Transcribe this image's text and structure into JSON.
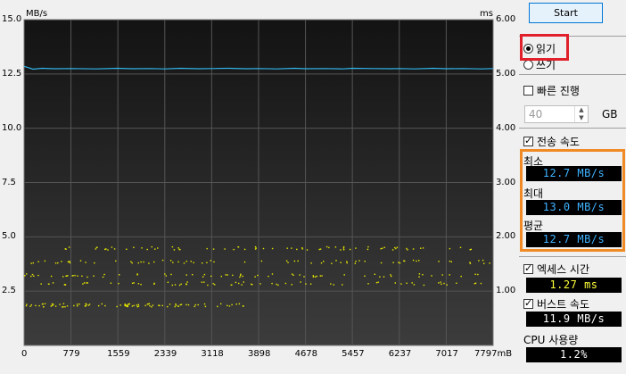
{
  "chart_data": {
    "type": "line",
    "left_unit": "MB/s",
    "right_unit": "ms",
    "y_ticks_left": [
      "15.0",
      "12.5",
      "10.0",
      "7.5",
      "5.0",
      "2.5"
    ],
    "y_ticks_right": [
      "6.00",
      "5.00",
      "4.00",
      "3.00",
      "2.00",
      "1.00"
    ],
    "ylim_left": [
      0,
      15
    ],
    "ylim_right": [
      0,
      6
    ],
    "x_ticks": [
      "0",
      "779",
      "1559",
      "2339",
      "3118",
      "3898",
      "4678",
      "5457",
      "6237",
      "7017",
      "7797mB"
    ],
    "x_tick_values": [
      0,
      779,
      1559,
      2339,
      3118,
      3898,
      4678,
      5457,
      6237,
      7017,
      7797
    ],
    "xlim": [
      0,
      7797
    ],
    "grid": true,
    "series": [
      {
        "name": "",
        "axis": "left",
        "color": "#31b4e8",
        "x": [
          0,
          150,
          300,
          500,
          800,
          1200,
          1559,
          1800,
          2100,
          2339,
          2600,
          2900,
          3118,
          3400,
          3700,
          3898,
          4200,
          4500,
          4678,
          5000,
          5300,
          5457,
          5800,
          6100,
          6237,
          6500,
          6800,
          7017,
          7300,
          7600,
          7797
        ],
        "values": [
          12.85,
          12.72,
          12.76,
          12.74,
          12.75,
          12.73,
          12.76,
          12.74,
          12.75,
          12.73,
          12.76,
          12.74,
          12.75,
          12.76,
          12.74,
          12.75,
          12.73,
          12.76,
          12.74,
          12.75,
          12.73,
          12.76,
          12.75,
          12.74,
          12.75,
          12.73,
          12.76,
          12.74,
          12.75,
          12.73,
          12.75
        ]
      },
      {
        "name": "",
        "axis": "right",
        "type": "scatter",
        "color": "#e8e800",
        "bands_ms": [
          0.75,
          1.15,
          1.3,
          1.55,
          1.8
        ],
        "band_extent_mB": [
          [
            0,
            3800
          ],
          [
            0,
            7797
          ],
          [
            0,
            7797
          ],
          [
            0,
            7797
          ],
          [
            500,
            7600
          ]
        ]
      }
    ]
  },
  "panel": {
    "start_label": "Start",
    "read_label": "읽기",
    "write_label": "쓰기",
    "read_selected": true,
    "fast_label": "빠른 진행",
    "fast_checked": false,
    "size_value": "40",
    "size_unit": "GB",
    "transfer_label": "전송 속도",
    "transfer_checked": true,
    "min_label": "최소",
    "min_value": "12.7 MB/s",
    "max_label": "최대",
    "max_value": "13.0 MB/s",
    "avg_label": "평균",
    "avg_value": "12.7 MB/s",
    "access_label": "엑세스 시간",
    "access_checked": true,
    "access_value": "1.27 ms",
    "burst_label": "버스트 속도",
    "burst_checked": true,
    "burst_value": "11.9 MB/s",
    "cpu_label": "CPU 사용량",
    "cpu_value": "1.2%"
  }
}
